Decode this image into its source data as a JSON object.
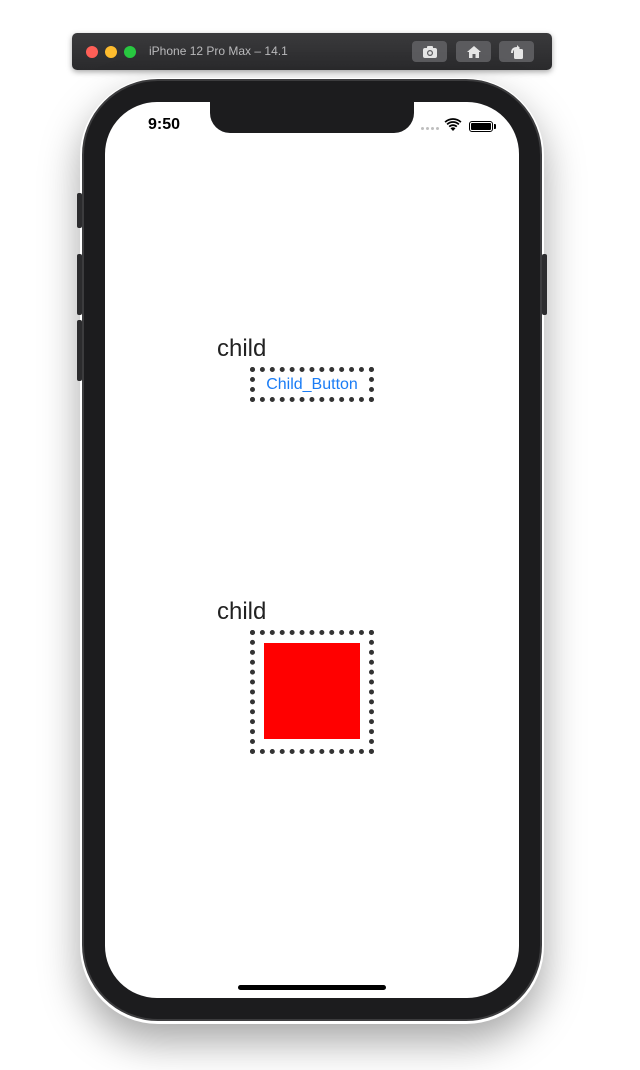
{
  "simulator": {
    "title": "iPhone 12 Pro Max – 14.1",
    "buttons": [
      "screenshot-icon",
      "home-icon",
      "rotate-icon"
    ]
  },
  "status_bar": {
    "time": "9:50"
  },
  "views": [
    {
      "label": "child",
      "button_label": "Child_Button"
    },
    {
      "label": "child",
      "fill_color": "#ff0000"
    }
  ],
  "colors": {
    "button_text": "#1a7cf5",
    "dotted_border": "#333333"
  }
}
